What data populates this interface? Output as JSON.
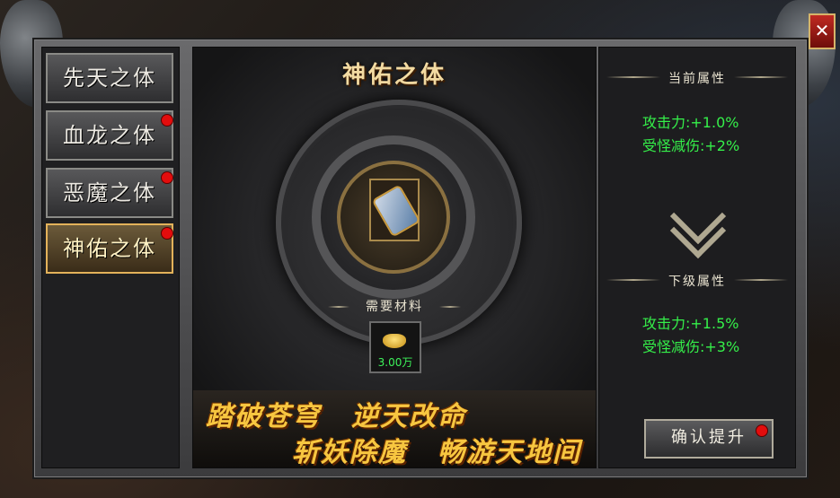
{
  "window": {
    "close_label": "✕"
  },
  "tabs": [
    {
      "label": "先天之体",
      "alert": false,
      "active": false
    },
    {
      "label": "血龙之体",
      "alert": true,
      "active": false
    },
    {
      "label": "恶魔之体",
      "alert": true,
      "active": false
    },
    {
      "label": "神佑之体",
      "alert": true,
      "active": true
    }
  ],
  "main": {
    "title": "神佑之体",
    "item_icon": "scroll-icon",
    "materials_label": "需要材料",
    "material": {
      "icon": "gold-ingot-icon",
      "quantity": "3.00万"
    },
    "slogans": [
      "踏破苍穹",
      "逆天改命",
      "斩妖除魔",
      "畅游天地间"
    ]
  },
  "side": {
    "current_header": "当前属性",
    "current_attrs": [
      "攻击力:+1.0%",
      "受怪减伤:+2%"
    ],
    "next_header": "下级属性",
    "next_attrs": [
      "攻击力:+1.5%",
      "受怪减伤:+3%"
    ],
    "confirm_label": "确认提升"
  },
  "colors": {
    "accent_gold": "#f7c640",
    "attr_green": "#35f04a",
    "alert_red": "#e30d0d"
  }
}
